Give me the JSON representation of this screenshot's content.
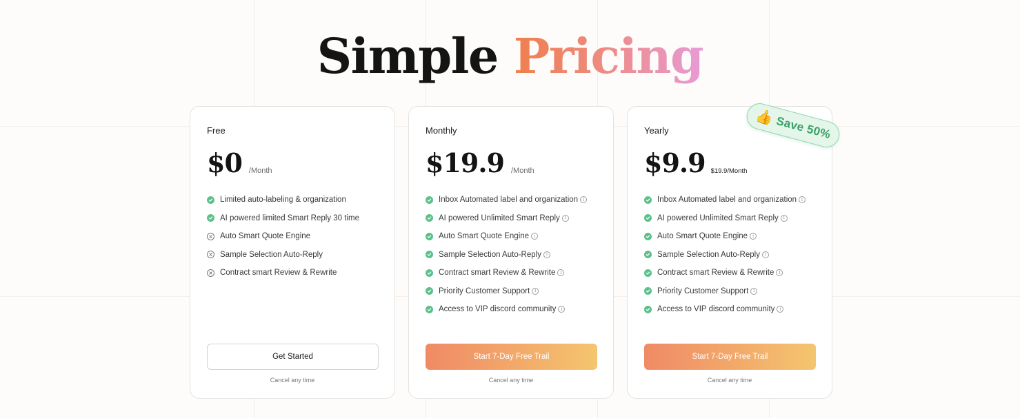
{
  "title": {
    "part1": "Simple",
    "part2": "Pricing"
  },
  "badge": {
    "icon": "thumbs-up-icon",
    "glyph": "👍",
    "text": "Save 50%"
  },
  "plans": [
    {
      "name": "Free",
      "price": "$0",
      "per": "/Month",
      "features": [
        {
          "text": "Limited auto-labeling & organization",
          "included": true,
          "info": false
        },
        {
          "text": "AI powered limited Smart Reply 30 time",
          "included": true,
          "info": false
        },
        {
          "text": "Auto Smart Quote Engine",
          "included": false,
          "info": false
        },
        {
          "text": "Sample Selection Auto-Reply",
          "included": false,
          "info": false
        },
        {
          "text": "Contract smart Review & Rewrite",
          "included": false,
          "info": false
        }
      ],
      "button": "Get Started",
      "cancel": "Cancel any time"
    },
    {
      "name": "Monthly",
      "price": "$19.9",
      "per": "/Month",
      "features": [
        {
          "text": "Inbox Automated label and organization",
          "included": true,
          "info": true
        },
        {
          "text": "AI powered Unlimited Smart Reply",
          "included": true,
          "info": true
        },
        {
          "text": "Auto Smart Quote Engine",
          "included": true,
          "info": true
        },
        {
          "text": "Sample Selection Auto-Reply",
          "included": true,
          "info": true
        },
        {
          "text": "Contract smart Review & Rewrite",
          "included": true,
          "info": true
        },
        {
          "text": "Priority Customer Support",
          "included": true,
          "info": true
        },
        {
          "text": "Access to VIP discord community",
          "included": true,
          "info": true
        }
      ],
      "button": "Start 7-Day Free Trail",
      "cancel": "Cancel any time"
    },
    {
      "name": "Yearly",
      "price": "$9.9",
      "per": "$19.9/Month",
      "features": [
        {
          "text": "Inbox Automated label and organization",
          "included": true,
          "info": true
        },
        {
          "text": "AI powered Unlimited Smart Reply",
          "included": true,
          "info": true
        },
        {
          "text": "Auto Smart Quote Engine",
          "included": true,
          "info": true
        },
        {
          "text": "Sample Selection Auto-Reply",
          "included": true,
          "info": true
        },
        {
          "text": "Contract smart Review & Rewrite",
          "included": true,
          "info": true
        },
        {
          "text": "Priority Customer Support",
          "included": true,
          "info": true
        },
        {
          "text": "Access to VIP discord community",
          "included": true,
          "info": true
        }
      ],
      "button": "Start 7-Day Free Trail",
      "cancel": "Cancel any time"
    }
  ],
  "colors": {
    "check": "#5cc08a",
    "accent_start": "#f08a66",
    "accent_end": "#f4c56f",
    "title_gradient": [
      "#ef7f4c",
      "#e79bd6"
    ],
    "badge_text": "#3aa166"
  }
}
